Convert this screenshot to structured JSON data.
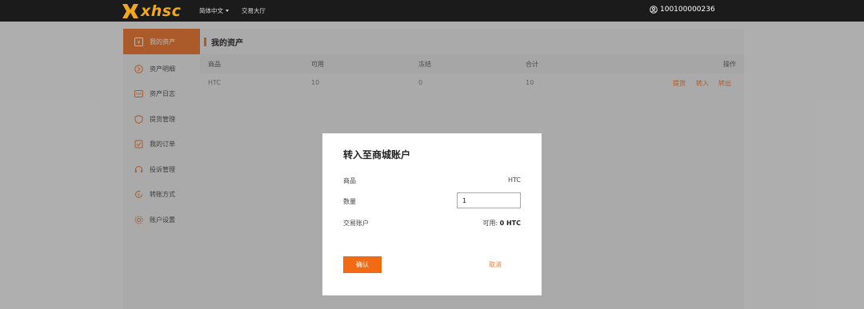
{
  "header": {
    "logo_text": "xhsc",
    "language": "简体中文",
    "nav_hall": "交易大厅",
    "account_id": "100100000236"
  },
  "sidebar": {
    "items": [
      {
        "label": "我的资产",
        "icon": "wallet-icon",
        "active": true
      },
      {
        "label": "资产明细",
        "icon": "coin-icon"
      },
      {
        "label": "资产日志",
        "icon": "log-icon"
      },
      {
        "label": "提货管理",
        "icon": "shield-icon"
      },
      {
        "label": "我的订单",
        "icon": "order-icon"
      },
      {
        "label": "投诉管理",
        "icon": "headset-icon"
      },
      {
        "label": "转账方式",
        "icon": "transfer-icon"
      },
      {
        "label": "账户设置",
        "icon": "gear-icon"
      }
    ]
  },
  "main": {
    "title": "我的资产",
    "columns": [
      "商品",
      "可用",
      "冻结",
      "合计",
      "操作"
    ],
    "rows": [
      {
        "product": "HTC",
        "available": "10",
        "frozen": "0",
        "total": "10",
        "actions": [
          "提货",
          "转入",
          "转出"
        ]
      }
    ]
  },
  "modal": {
    "title": "转入至商城账户",
    "product_label": "商品",
    "product_value": "HTC",
    "quantity_label": "数量",
    "quantity_value": "1",
    "account_label": "交易账户",
    "available_prefix": "可用:",
    "available_value": "0 HTC",
    "confirm_label": "确认",
    "cancel_label": "取消"
  },
  "colors": {
    "accent": "#ed7f3a",
    "confirm_button": "#f26a14",
    "logo": "#f0a81c",
    "topbar": "#1b1b1b"
  }
}
